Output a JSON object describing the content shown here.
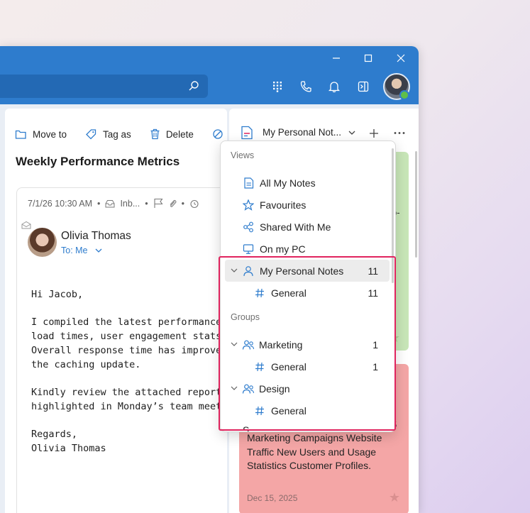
{
  "titlebar": {
    "search_icon": "search-icon",
    "icons": [
      "apps-grid-icon",
      "phone-icon",
      "bell-icon",
      "side-panel-icon"
    ]
  },
  "toolbar": {
    "move_to": "Move to",
    "tag_as": "Tag as",
    "delete": "Delete"
  },
  "message": {
    "subject": "Weekly Performance Metrics",
    "datetime": "7/1/26 10:30 AM",
    "folder": "Inb...",
    "sender_name": "Olivia Thomas",
    "to": "To: Me",
    "body": {
      "greeting": "Hi Jacob,",
      "para1": [
        "I compiled the latest performance met",
        "load times, user engagement stats, an",
        "Overall response time has improved by",
        "the caching update."
      ],
      "para2": [
        "Kindly review the attached report and",
        "highlighted in Monday’s team meeting."
      ],
      "closing": [
        "Regards,",
        "Olivia Thomas"
      ]
    }
  },
  "notes_panel": {
    "title": "My Personal Not...",
    "green_note_fragment": "o-",
    "red_note_fragment": "5",
    "red_note_body": "Marketing Campaigns Website Traffic New Users and Usage Statistics Customer Profiles.",
    "red_note_date": "Dec 15, 2025"
  },
  "dropdown": {
    "views_label": "Views",
    "views": [
      {
        "label": "All My Notes",
        "icon": "note-icon"
      },
      {
        "label": "Favourites",
        "icon": "star-icon"
      },
      {
        "label": "Shared With Me",
        "icon": "share-icon"
      },
      {
        "label": "On my PC",
        "icon": "monitor-icon"
      }
    ],
    "personal": {
      "label": "My Personal Notes",
      "count": "11"
    },
    "personal_general": {
      "label": "General",
      "count": "11"
    },
    "groups_label": "Groups",
    "marketing": {
      "label": "Marketing",
      "count": "1"
    },
    "marketing_general": {
      "label": "General",
      "count": "1"
    },
    "design": {
      "label": "Design"
    },
    "design_general": {
      "label": "General"
    },
    "cut_off": "S..."
  },
  "colors": {
    "titlebar": "#2e7ccd",
    "accent": "#2e7ccd",
    "highlight": "#e0245e",
    "note_green": "#c8e6b8",
    "note_red": "#f4a6a6"
  }
}
